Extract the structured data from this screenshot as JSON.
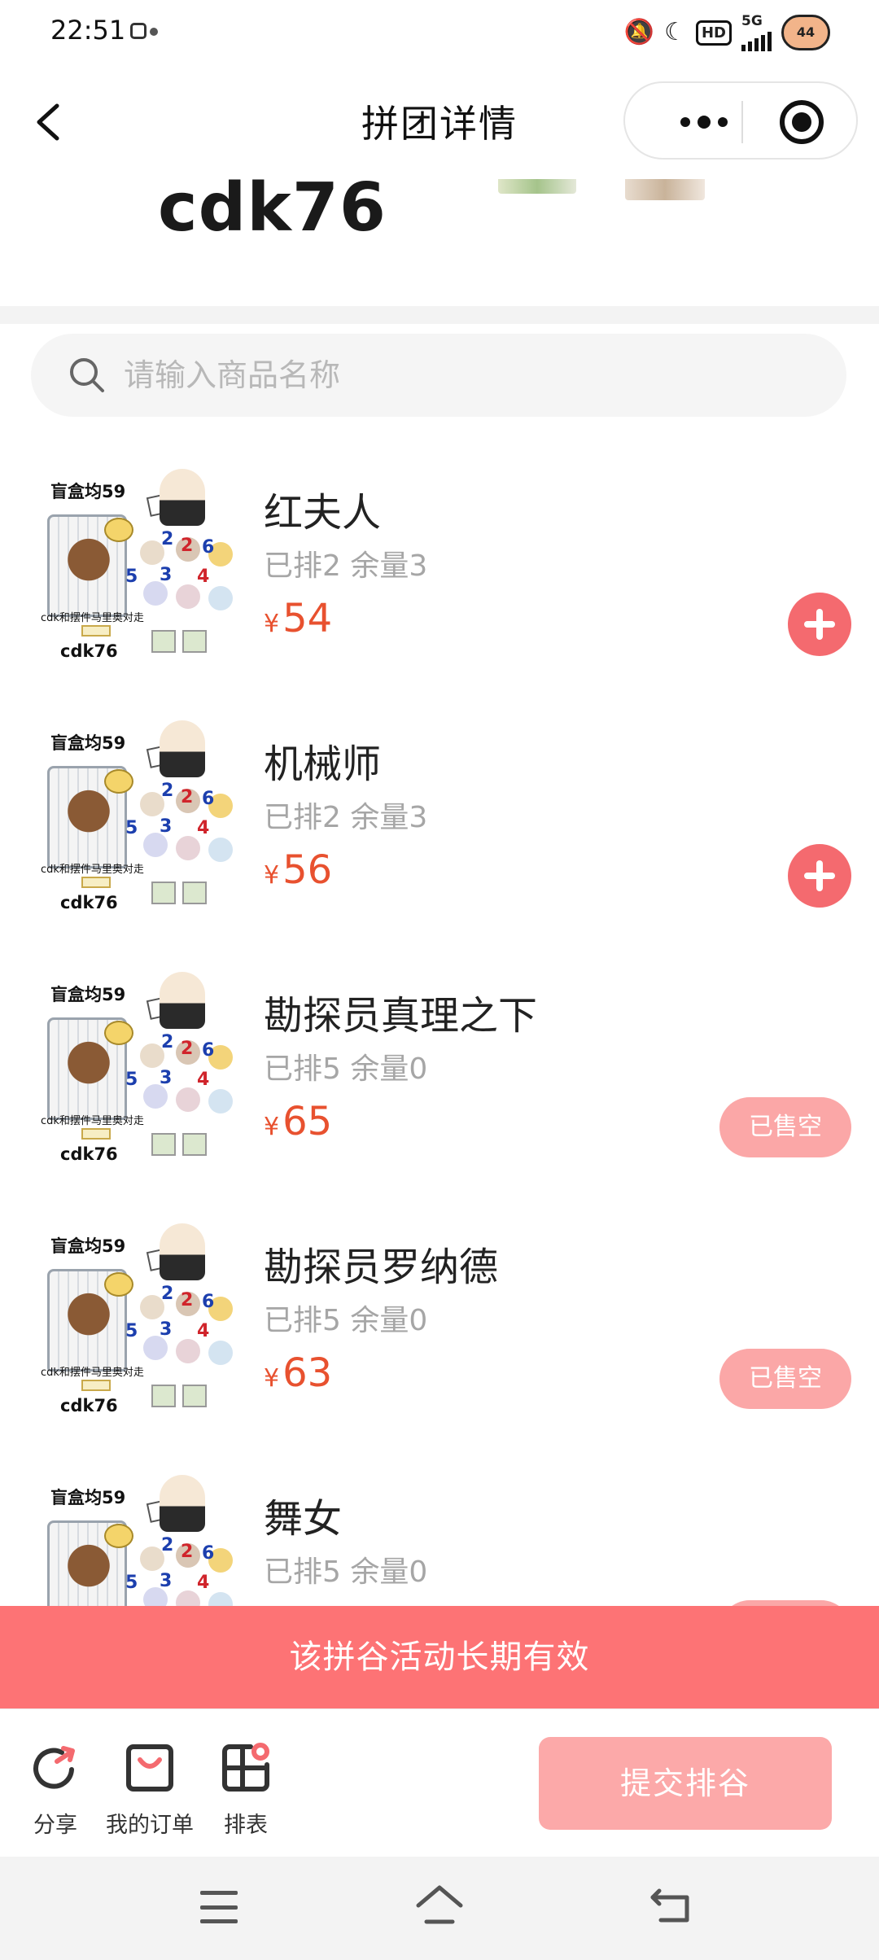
{
  "status_bar": {
    "time": "22:51",
    "hd": "HD",
    "network": "5G",
    "battery_level": "44"
  },
  "nav": {
    "title": "拼团详情"
  },
  "header": {
    "shop_name": "cdk76"
  },
  "search": {
    "placeholder": "请输入商品名称",
    "value": ""
  },
  "product_image": {
    "label_top": "盲盒均59",
    "label_bottom": "cdk76",
    "caption": "cdk和摆件马里奥对走",
    "digits": [
      "2",
      "2",
      "6",
      "5",
      "3",
      "4"
    ]
  },
  "products": [
    {
      "name": "红夫人",
      "stock": "已排2 余量3",
      "currency": "¥",
      "price": "54",
      "action": "add"
    },
    {
      "name": "机械师",
      "stock": "已排2 余量3",
      "currency": "¥",
      "price": "56",
      "action": "add"
    },
    {
      "name": "勘探员真理之下",
      "stock": "已排5 余量0",
      "currency": "¥",
      "price": "65",
      "action": "soldout",
      "action_label": "已售空"
    },
    {
      "name": "勘探员罗纳德",
      "stock": "已排5 余量0",
      "currency": "¥",
      "price": "63",
      "action": "soldout",
      "action_label": "已售空"
    },
    {
      "name": "舞女",
      "stock": "已排5 余量0",
      "currency": "¥",
      "price": "",
      "action": "soldout",
      "action_label": "已售空"
    }
  ],
  "notice": "该拼谷活动长期有效",
  "toolbar": {
    "share_label": "分享",
    "orders_label": "我的订单",
    "ranking_label": "排表",
    "submit_label": "提交排谷"
  },
  "colors": {
    "accent": "#fd7375",
    "price": "#e8512f",
    "add_button": "#f46a6f",
    "soldout_button": "#fba7a7",
    "submit_button": "#fca9a9"
  },
  "icons": [
    "back-icon",
    "more-icon",
    "target-icon",
    "search-icon",
    "add-icon",
    "share-icon",
    "orders-icon",
    "ranking-icon",
    "menu-icon",
    "home-icon",
    "system-back-icon"
  ]
}
